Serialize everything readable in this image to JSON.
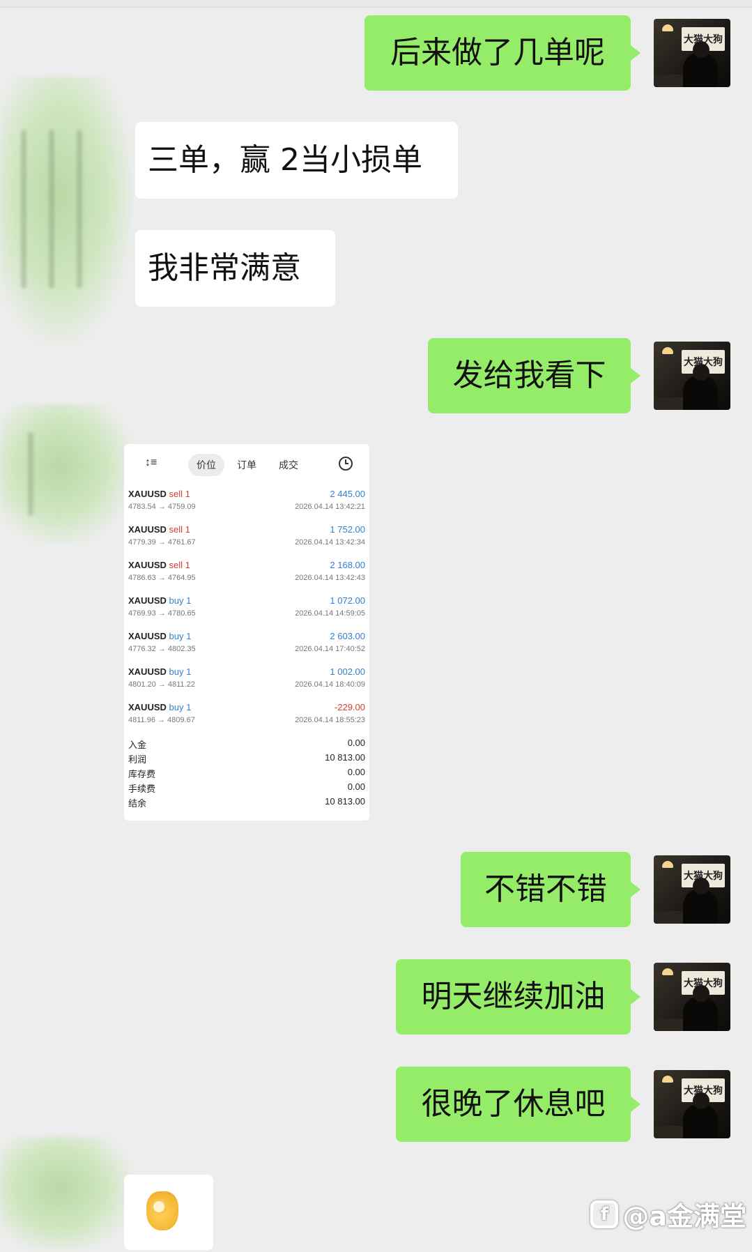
{
  "messages": {
    "m1": "后来做了几单呢",
    "m2": "三单，赢 2当小损单",
    "m3": "我非常满意",
    "m4": "发给我看下",
    "m5": "不错不错",
    "m6": "明天继续加油",
    "m7": "很晚了休息吧"
  },
  "avatar_sign": "大猫大狗",
  "trade_screen": {
    "tabs": [
      "价位",
      "订单",
      "成交"
    ],
    "active_tab": "价位",
    "deals": [
      {
        "symbol": "XAUUSD",
        "side": "sell 1",
        "prices": "4783.54 → 4759.09",
        "profit": "2 445.00",
        "time": "2026.04.14 13:42:21"
      },
      {
        "symbol": "XAUUSD",
        "side": "sell 1",
        "prices": "4779.39 → 4761.67",
        "profit": "1 752.00",
        "time": "2026.04.14 13:42:34"
      },
      {
        "symbol": "XAUUSD",
        "side": "sell 1",
        "prices": "4786.63 → 4764.95",
        "profit": "2 168.00",
        "time": "2026.04.14 13:42:43"
      },
      {
        "symbol": "XAUUSD",
        "side": "buy 1",
        "prices": "4769.93 → 4780.65",
        "profit": "1 072.00",
        "time": "2026.04.14 14:59:05"
      },
      {
        "symbol": "XAUUSD",
        "side": "buy 1",
        "prices": "4776.32 → 4802.35",
        "profit": "2 603.00",
        "time": "2026.04.14 17:40:52"
      },
      {
        "symbol": "XAUUSD",
        "side": "buy 1",
        "prices": "4801.20 → 4811.22",
        "profit": "1 002.00",
        "time": "2026.04.14 18:40:09"
      },
      {
        "symbol": "XAUUSD",
        "side": "buy 1",
        "prices": "4811.96 → 4809.67",
        "profit": "-229.00",
        "time": "2026.04.14 18:55:23"
      }
    ],
    "summary": [
      {
        "label": "入金",
        "value": "0.00"
      },
      {
        "label": "利润",
        "value": "10 813.00"
      },
      {
        "label": "库存费",
        "value": "0.00"
      },
      {
        "label": "手续费",
        "value": "0.00"
      },
      {
        "label": "结余",
        "value": "10 813.00"
      }
    ]
  },
  "watermark": {
    "logo": "f",
    "text": "@a金满堂"
  },
  "colors": {
    "outgoing_bubble": "#95ec69",
    "incoming_bubble": "#ffffff",
    "background": "#ededed",
    "sell": "#d93a32",
    "buy": "#2f7fd1"
  }
}
